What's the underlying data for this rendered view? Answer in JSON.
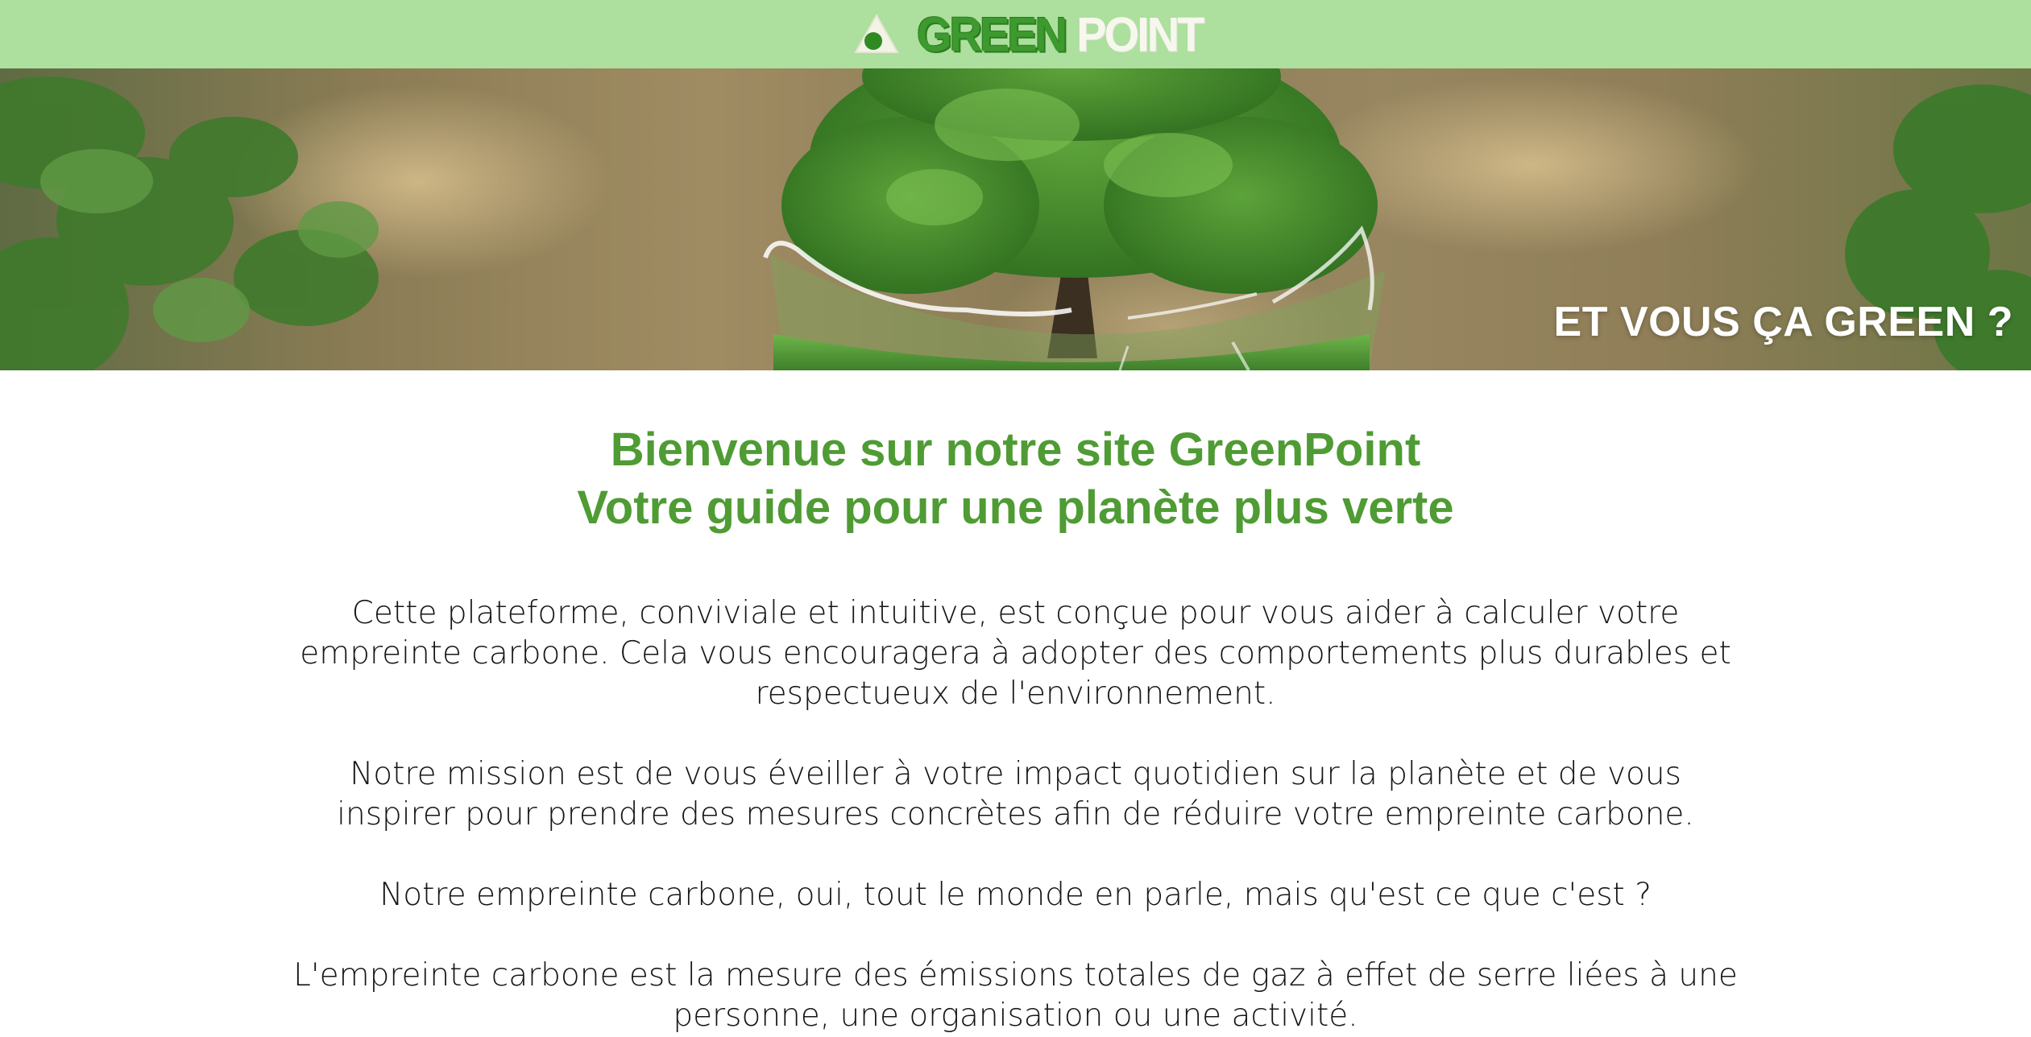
{
  "header": {
    "logo_green": "GREEN",
    "logo_point": "POINT",
    "logo_icon": "green-point-logo-icon"
  },
  "hero": {
    "image": "tree-in-broken-glass-sphere-banner",
    "tagline": "ET VOUS ÇA GREEN ?"
  },
  "main": {
    "welcome_line1": "Bienvenue sur notre site GreenPoint",
    "welcome_line2": "Votre guide pour une planète plus verte",
    "paragraphs": [
      "Cette plateforme, conviviale et intuitive, est conçue pour vous aider à calculer votre empreinte carbone. Cela vous encouragera à adopter des comportements plus durables et respectueux de l'environnement.",
      "Notre mission est de vous éveiller à votre impact quotidien sur la planète et de vous inspirer pour prendre des mesures concrètes afin de réduire votre empreinte carbone.",
      "Notre empreinte carbone, oui, tout le monde en parle, mais qu'est ce que c'est ?",
      "L'empreinte carbone est la mesure des émissions totales de gaz à effet de serre liées à une personne, une organisation ou une activité."
    ]
  },
  "colors": {
    "header_bg": "#addf9e",
    "brand_green": "#3d9a2e",
    "heading_green": "#4f9b34",
    "text": "#161616"
  }
}
